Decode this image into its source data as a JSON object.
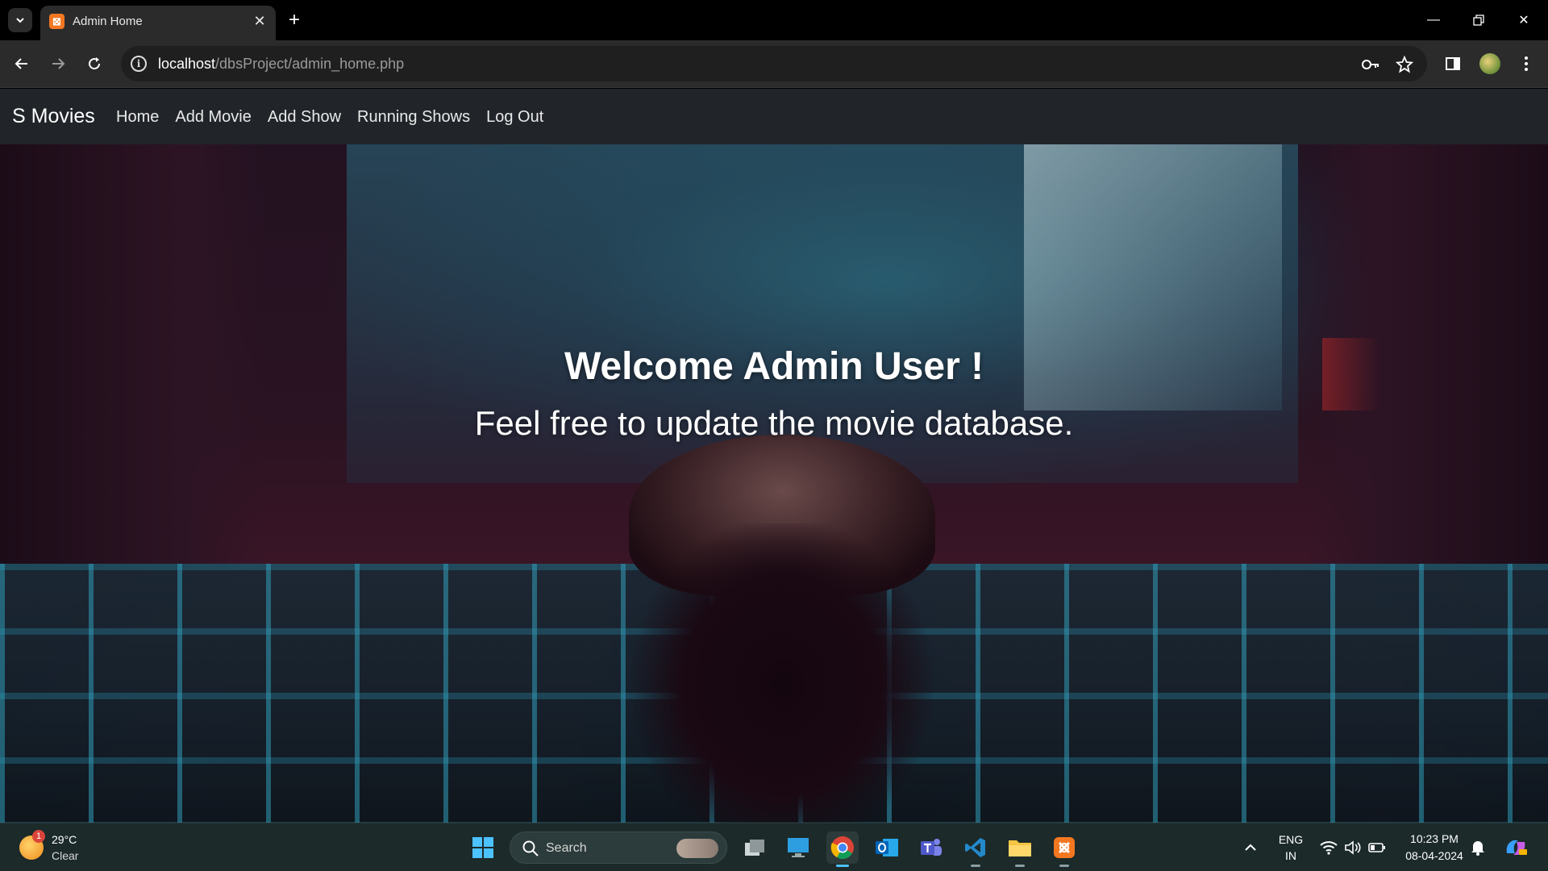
{
  "browser": {
    "tab_title": "Admin Home",
    "url_host": "localhost",
    "url_path": "/dbsProject/admin_home.php"
  },
  "site": {
    "brand": "S Movies",
    "nav": [
      {
        "label": "Home"
      },
      {
        "label": "Add Movie"
      },
      {
        "label": "Add Show"
      },
      {
        "label": "Running Shows"
      },
      {
        "label": "Log Out"
      }
    ]
  },
  "hero": {
    "title": "Welcome Admin User !",
    "subtitle": "Feel free to update the movie database."
  },
  "taskbar": {
    "weather_badge": "1",
    "temperature": "29°C",
    "condition": "Clear",
    "search_label": "Search",
    "lang_primary": "ENG",
    "lang_secondary": "IN",
    "time": "10:23 PM",
    "date": "08-04-2024"
  },
  "colors": {
    "navbar_bg": "#212529",
    "toolbar_bg": "#2b2b2b",
    "taskbar_bg": "#1c2a2a",
    "xampp_orange": "#f37721",
    "accent_blue": "#4cc2ff"
  }
}
